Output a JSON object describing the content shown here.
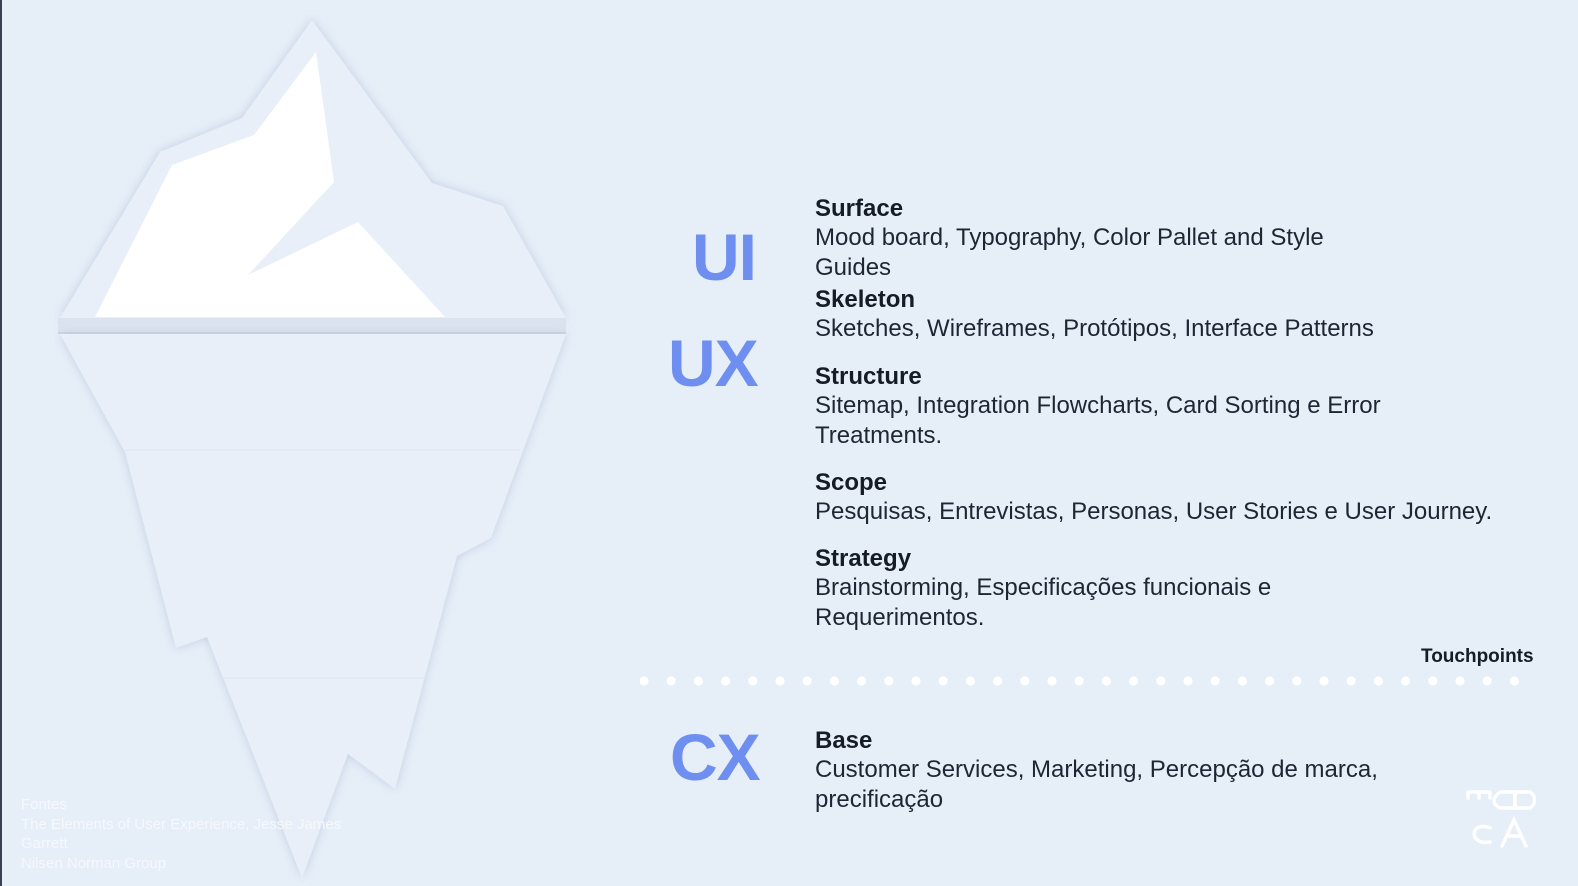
{
  "big_labels": {
    "ui": "UI",
    "ux": "UX",
    "cx": "CX"
  },
  "layers": [
    {
      "title": "Surface",
      "desc_lines": [
        "Mood board, Typography, Color Pallet and Style",
        "Guides"
      ]
    },
    {
      "title": "Skeleton",
      "desc_lines": [
        "Sketches, Wireframes, Protótipos, Interface Patterns"
      ]
    },
    {
      "title": "Structure",
      "desc_lines": [
        "Sitemap, Integration Flowcharts, Card Sorting e Error",
        "Treatments."
      ]
    },
    {
      "title": "Scope",
      "desc_lines": [
        "Pesquisas, Entrevistas, Personas, User Stories e User Journey."
      ]
    },
    {
      "title": "Strategy",
      "desc_lines": [
        "Brainstorming, Especificações funcionais e",
        "Requerimentos."
      ]
    },
    {
      "title": "Base",
      "desc_lines": [
        "Customer Services, Marketing, Percepção de marca,",
        "precificação"
      ]
    }
  ],
  "touchpoints_label": "Touchpoints",
  "sources": {
    "heading": "Fontes",
    "lines": [
      "The Elements of User Experience, Jesse James",
      "Garrett",
      "Nilsen Norman Group"
    ]
  },
  "logo": {
    "lines": [
      "EBA",
      "CA"
    ]
  },
  "colors": {
    "accent": "#6e8ff0",
    "background": "#e6eef8",
    "iceberg": "#e8eff8",
    "snow": "#ffffff",
    "text": "#1e2533"
  },
  "icons": [
    "iceberg-illustration",
    "dotted-separator",
    "ebac-logo"
  ]
}
